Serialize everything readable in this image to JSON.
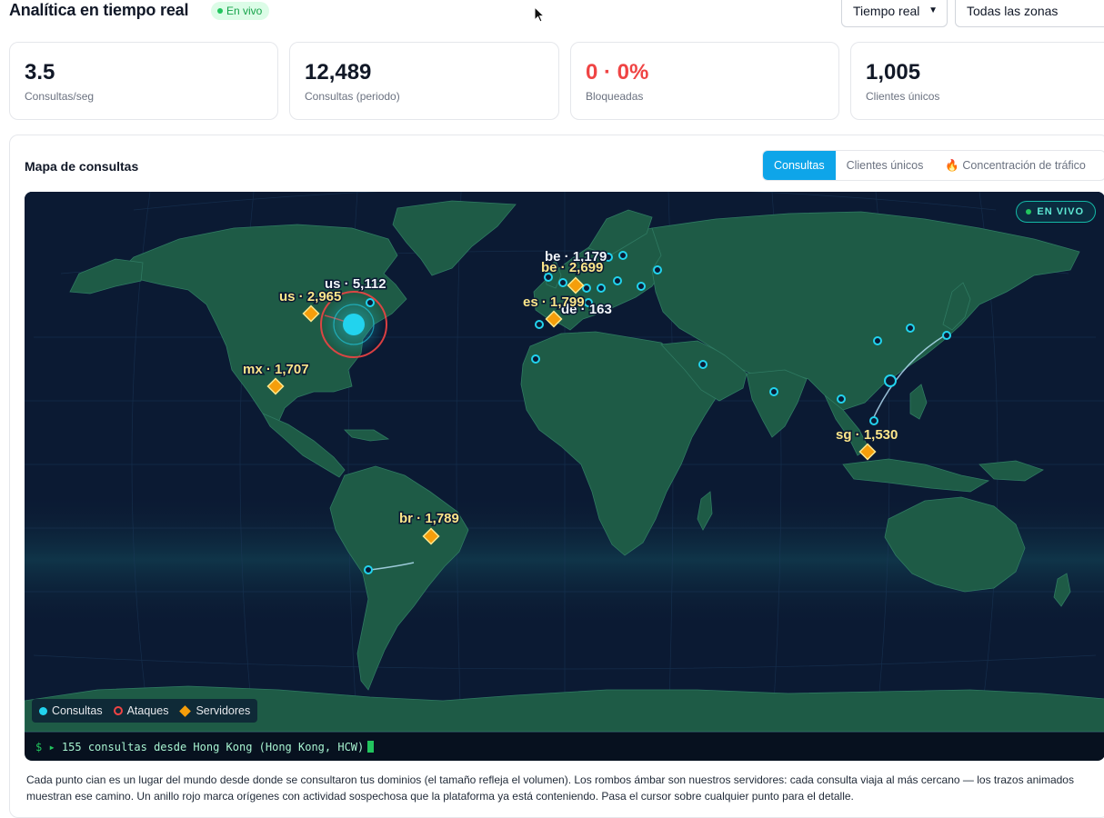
{
  "header": {
    "title": "Analítica en tiempo real",
    "badge": "En vivo",
    "range_select": "Tiempo real",
    "zone_select": "Todas las zonas"
  },
  "stats": [
    {
      "value": "3.5",
      "label": "Consultas/seg"
    },
    {
      "value": "12,489",
      "label": "Consultas (periodo)"
    },
    {
      "value": "0 · 0%",
      "label": "Bloqueadas"
    },
    {
      "value": "1,005",
      "label": "Clientes únicos"
    }
  ],
  "map_card": {
    "title": "Mapa de consultas",
    "tabs": [
      "Consultas",
      "Clientes únicos",
      "🔥 Concentración de tráfico"
    ],
    "live_pill": "EN VIVO"
  },
  "map_labels": {
    "us_query": "us · 5,112",
    "us_server": "us · 2,965",
    "mx_server": "mx · 1,707",
    "be_query": "be · 1,179",
    "be_server": "be · 2,699",
    "es_server": "es · 1,799",
    "de_query": "de · 163",
    "sg_server": "sg · 1,530",
    "br_server": "br · 1,789"
  },
  "legend": {
    "queries": "Consultas",
    "attacks": "Ataques",
    "servers": "Servidores"
  },
  "terminal": {
    "prompt": "$ ▸",
    "message": "155 consultas desde Hong Kong (Hong Kong, HCW)"
  },
  "description": "Cada punto cian es un lugar del mundo desde donde se consultaron tus dominios (el tamaño refleja el volumen). Los rombos ámbar son nuestros servidores: cada consulta viaja al más cercano — los trazos animados muestran ese camino. Un anillo rojo marca orígenes con actividad sospechosa que la plataforma ya está conteniendo. Pasa el cursor sobre cualquier punto para el detalle.",
  "colors": {
    "accent": "#0ea5e9",
    "query_dot": "#22d3ee",
    "attack_ring": "#ef4444",
    "server_diamond": "#f59e0b",
    "land": "#1e5b46",
    "ocean": "#0b1a33"
  }
}
